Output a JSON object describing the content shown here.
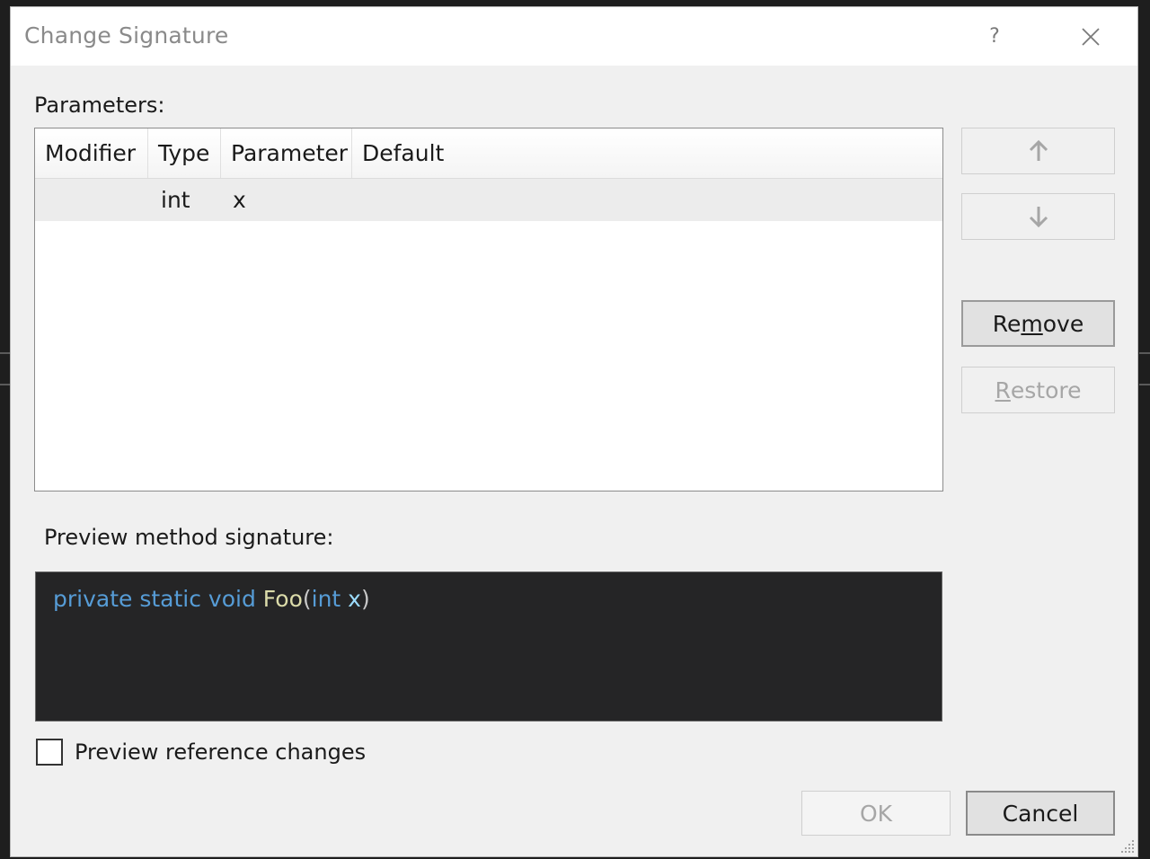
{
  "dialog": {
    "title": "Change Signature",
    "help_label": "?",
    "close_label": "✕"
  },
  "parameters": {
    "label": "Parameters:",
    "columns": [
      "Modifier",
      "Type",
      "Parameter",
      "Default"
    ],
    "rows": [
      {
        "modifier": "",
        "type": "int",
        "parameter": "x",
        "default": ""
      }
    ]
  },
  "side_buttons": {
    "move_up_icon": "arrow-up-icon",
    "move_down_icon": "arrow-down-icon",
    "remove": {
      "before": "Re",
      "mnemonic": "m",
      "after": "ove"
    },
    "restore": {
      "before": "",
      "mnemonic": "R",
      "after": "estore"
    }
  },
  "preview": {
    "label": "Preview method signature:",
    "tokens": {
      "modifiers": "private static void ",
      "method": "Foo",
      "open_paren": "(",
      "param_type": "int",
      "param_name": " x",
      "close_paren": ")"
    },
    "colors": {
      "keyword": "#569cd6",
      "method": "#dcdcaa",
      "background": "#252526"
    }
  },
  "options": {
    "preview_reference_changes": {
      "label": "Preview reference changes",
      "checked": false
    }
  },
  "footer": {
    "ok_label": "OK",
    "cancel_label": "Cancel"
  }
}
